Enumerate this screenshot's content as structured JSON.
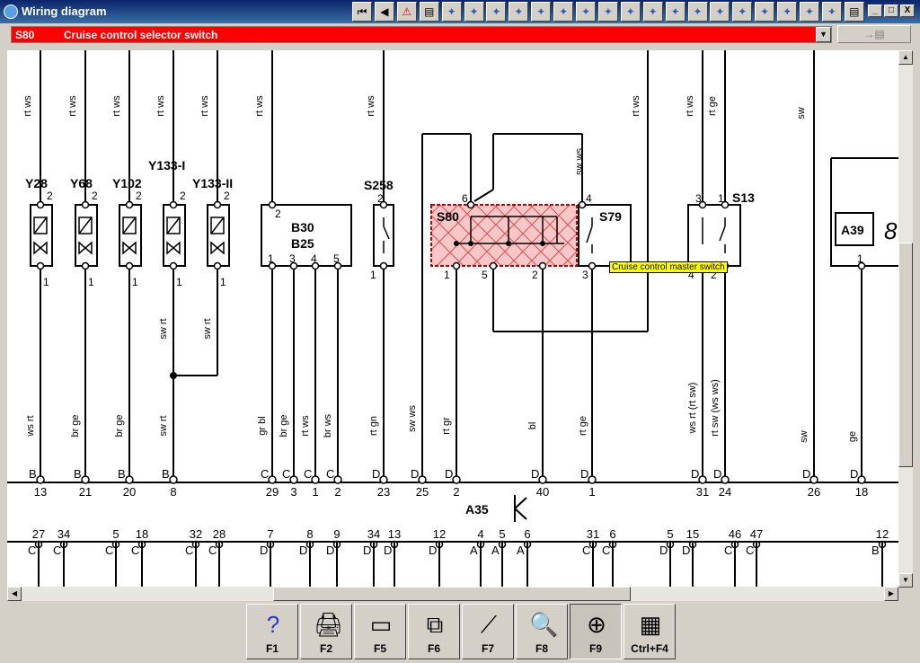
{
  "window": {
    "title": "Wiring diagram"
  },
  "toolbar": {
    "nav_icons": [
      "skip-first-icon",
      "prev-icon",
      "warning-icon",
      "document-icon",
      "tool-icon",
      "tool-icon",
      "tool-icon",
      "tool-icon",
      "tool-icon",
      "tool-icon",
      "tool-icon",
      "tool-icon",
      "tool-icon",
      "tool-icon",
      "tool-icon",
      "tool-icon",
      "tool-icon",
      "tool-icon",
      "tool-icon",
      "tool-icon",
      "tool-icon",
      "tool-icon",
      "document-icon"
    ],
    "window_buttons": {
      "minimize": "_",
      "restore": "□",
      "close": "X"
    }
  },
  "selector": {
    "code": "S80",
    "description": "Cruise control selector switch"
  },
  "go_button": {
    "label": "→▤"
  },
  "tooltip": {
    "text": "Cruise control master switch"
  },
  "diagram": {
    "components": {
      "Y28": "Y28",
      "Y68": "Y68",
      "Y102": "Y102",
      "Y133_I": "Y133-I",
      "Y133_II": "Y133-II",
      "B30": "B30",
      "B25": "B25",
      "S258": "S258",
      "S80": "S80",
      "S79": "S79",
      "S13": "S13",
      "A39": "A39",
      "A35": "A35"
    },
    "top_wire_labels": [
      "rt ws",
      "rt ws",
      "rt ws",
      "rt ws",
      "rt ws",
      "rt ws",
      "rt ws",
      "sw ws",
      "rt ws",
      "rt ws",
      "rt ge",
      "sw"
    ],
    "mid_wire_labels": [
      "sw rt",
      "sw rt"
    ],
    "bottom_wire_labels": [
      "ws rt",
      "br ge",
      "br ge",
      "sw rt",
      "gr bl",
      "br ge",
      "rt ws",
      "br ws",
      "rt gn",
      "sw ws",
      "rt gr",
      "bl",
      "rt ge",
      "ws rt (rt sw)",
      "rt sw (ws ws)",
      "sw",
      "ge"
    ],
    "connector_letters": [
      "B",
      "B",
      "B",
      "B",
      "C",
      "C",
      "C",
      "C",
      "D",
      "D",
      "D",
      "D",
      "D",
      "D",
      "D",
      "D",
      "D"
    ],
    "connector_numbers": [
      "13",
      "21",
      "20",
      "8",
      "29",
      "3",
      "1",
      "2",
      "23",
      "25",
      "2",
      "40",
      "1",
      "31",
      "24",
      "26",
      "18"
    ],
    "top_pins": [
      "2",
      "2",
      "2",
      "2",
      "2",
      "2",
      "2",
      "6",
      "4",
      "3",
      "1"
    ],
    "bottom_pins": [
      "1",
      "1",
      "1",
      "1",
      "1",
      "1",
      "3",
      "4",
      "5",
      "1",
      "1",
      "5",
      "2",
      "3",
      "4",
      "2",
      "1"
    ],
    "bus_numbers": [
      "27",
      "34",
      "5",
      "18",
      "32",
      "28",
      "7",
      "8",
      "9",
      "34",
      "13",
      "12",
      "4",
      "5",
      "6",
      "31",
      "6",
      "5",
      "15",
      "46",
      "47",
      "12"
    ],
    "bus_letters": [
      "C",
      "C",
      "C",
      "C",
      "C",
      "C",
      "D",
      "D",
      "D",
      "D",
      "D",
      "D",
      "A",
      "A",
      "A",
      "C",
      "C",
      "D",
      "D",
      "C",
      "C",
      "B"
    ]
  },
  "fkeys": [
    {
      "label": "F1",
      "icon": "help-icon"
    },
    {
      "label": "F2",
      "icon": "print-setup-icon"
    },
    {
      "label": "F5",
      "icon": "printer-icon"
    },
    {
      "label": "F6",
      "icon": "connector-icon"
    },
    {
      "label": "F7",
      "icon": "probe-icon"
    },
    {
      "label": "F8",
      "icon": "magnify-component-icon"
    },
    {
      "label": "F9",
      "icon": "magnify-ground-icon"
    },
    {
      "label": "Ctrl+F4",
      "icon": "table-icon"
    }
  ]
}
